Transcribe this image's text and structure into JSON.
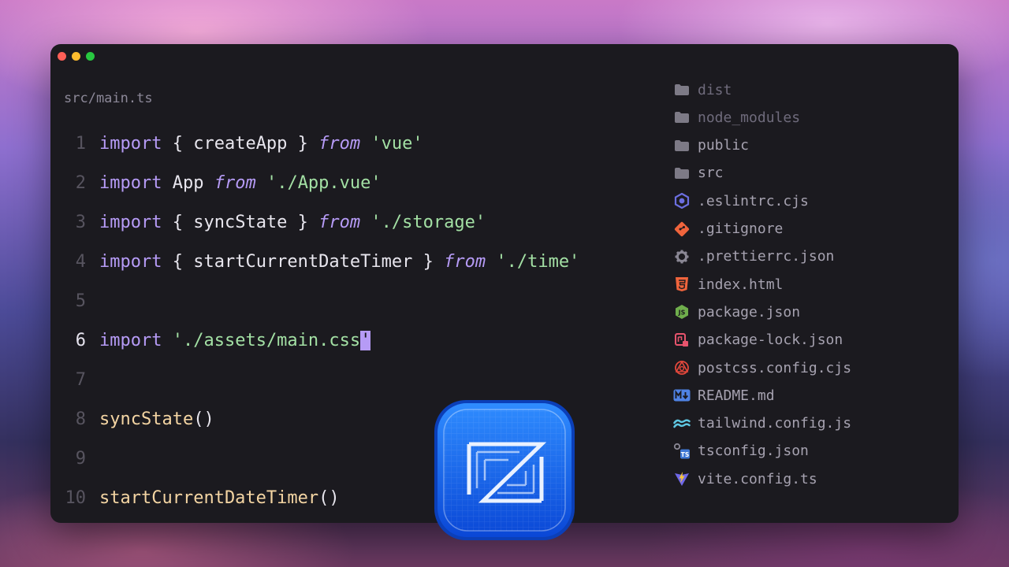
{
  "window": {
    "file_path": "src/main.ts"
  },
  "editor": {
    "lines": [
      {
        "num": "1",
        "parts": [
          {
            "t": "import",
            "c": "kw"
          },
          {
            "t": " { createApp } ",
            "c": "plain"
          },
          {
            "t": "from",
            "c": "from"
          },
          {
            "t": " ",
            "c": "plain"
          },
          {
            "t": "'vue'",
            "c": "str"
          }
        ]
      },
      {
        "num": "2",
        "parts": [
          {
            "t": "import",
            "c": "kw"
          },
          {
            "t": " App ",
            "c": "plain"
          },
          {
            "t": "from",
            "c": "from"
          },
          {
            "t": " ",
            "c": "plain"
          },
          {
            "t": "'./App.vue'",
            "c": "str"
          }
        ]
      },
      {
        "num": "3",
        "parts": [
          {
            "t": "import",
            "c": "kw"
          },
          {
            "t": " { syncState } ",
            "c": "plain"
          },
          {
            "t": "from",
            "c": "from"
          },
          {
            "t": " ",
            "c": "plain"
          },
          {
            "t": "'./storage'",
            "c": "str"
          }
        ]
      },
      {
        "num": "4",
        "parts": [
          {
            "t": "import",
            "c": "kw"
          },
          {
            "t": " { startCurrentDateTimer } ",
            "c": "plain"
          },
          {
            "t": "from",
            "c": "from"
          },
          {
            "t": " ",
            "c": "plain"
          },
          {
            "t": "'./time'",
            "c": "str"
          }
        ]
      },
      {
        "num": "5",
        "parts": []
      },
      {
        "num": "6",
        "active": true,
        "parts": [
          {
            "t": "import",
            "c": "kw"
          },
          {
            "t": " ",
            "c": "plain"
          },
          {
            "t": "'./assets/main.css",
            "c": "str"
          },
          {
            "t": "'",
            "c": "cursor"
          }
        ]
      },
      {
        "num": "7",
        "parts": []
      },
      {
        "num": "8",
        "parts": [
          {
            "t": "syncState",
            "c": "fn"
          },
          {
            "t": "()",
            "c": "plain"
          }
        ]
      },
      {
        "num": "9",
        "parts": []
      },
      {
        "num": "10",
        "parts": [
          {
            "t": "startCurrentDateTimer",
            "c": "fn"
          },
          {
            "t": "()",
            "c": "plain"
          }
        ]
      }
    ]
  },
  "file_tree": {
    "items": [
      {
        "label": "dist",
        "icon": "folder-icon",
        "dim": true
      },
      {
        "label": "node_modules",
        "icon": "folder-icon",
        "dim": true
      },
      {
        "label": "public",
        "icon": "folder-icon"
      },
      {
        "label": "src",
        "icon": "folder-icon"
      },
      {
        "label": ".eslintrc.cjs",
        "icon": "eslint-icon"
      },
      {
        "label": ".gitignore",
        "icon": "git-icon"
      },
      {
        "label": ".prettierrc.json",
        "icon": "gear-icon"
      },
      {
        "label": "index.html",
        "icon": "html5-icon"
      },
      {
        "label": "package.json",
        "icon": "nodejs-icon"
      },
      {
        "label": "package-lock.json",
        "icon": "npm-lock-icon"
      },
      {
        "label": "postcss.config.cjs",
        "icon": "postcss-icon"
      },
      {
        "label": "README.md",
        "icon": "markdown-icon"
      },
      {
        "label": "tailwind.config.js",
        "icon": "tailwind-icon"
      },
      {
        "label": "tsconfig.json",
        "icon": "typescript-config-icon"
      },
      {
        "label": "vite.config.ts",
        "icon": "vite-icon"
      }
    ]
  },
  "colors": {
    "keyword": "#b69bf6",
    "string": "#a3e0a4",
    "function": "#f4d5a3",
    "window_bg": "#1b1a1f",
    "accent_cursor": "#b69bf6"
  },
  "app_icon": {
    "icon": "zed-logo-icon"
  }
}
